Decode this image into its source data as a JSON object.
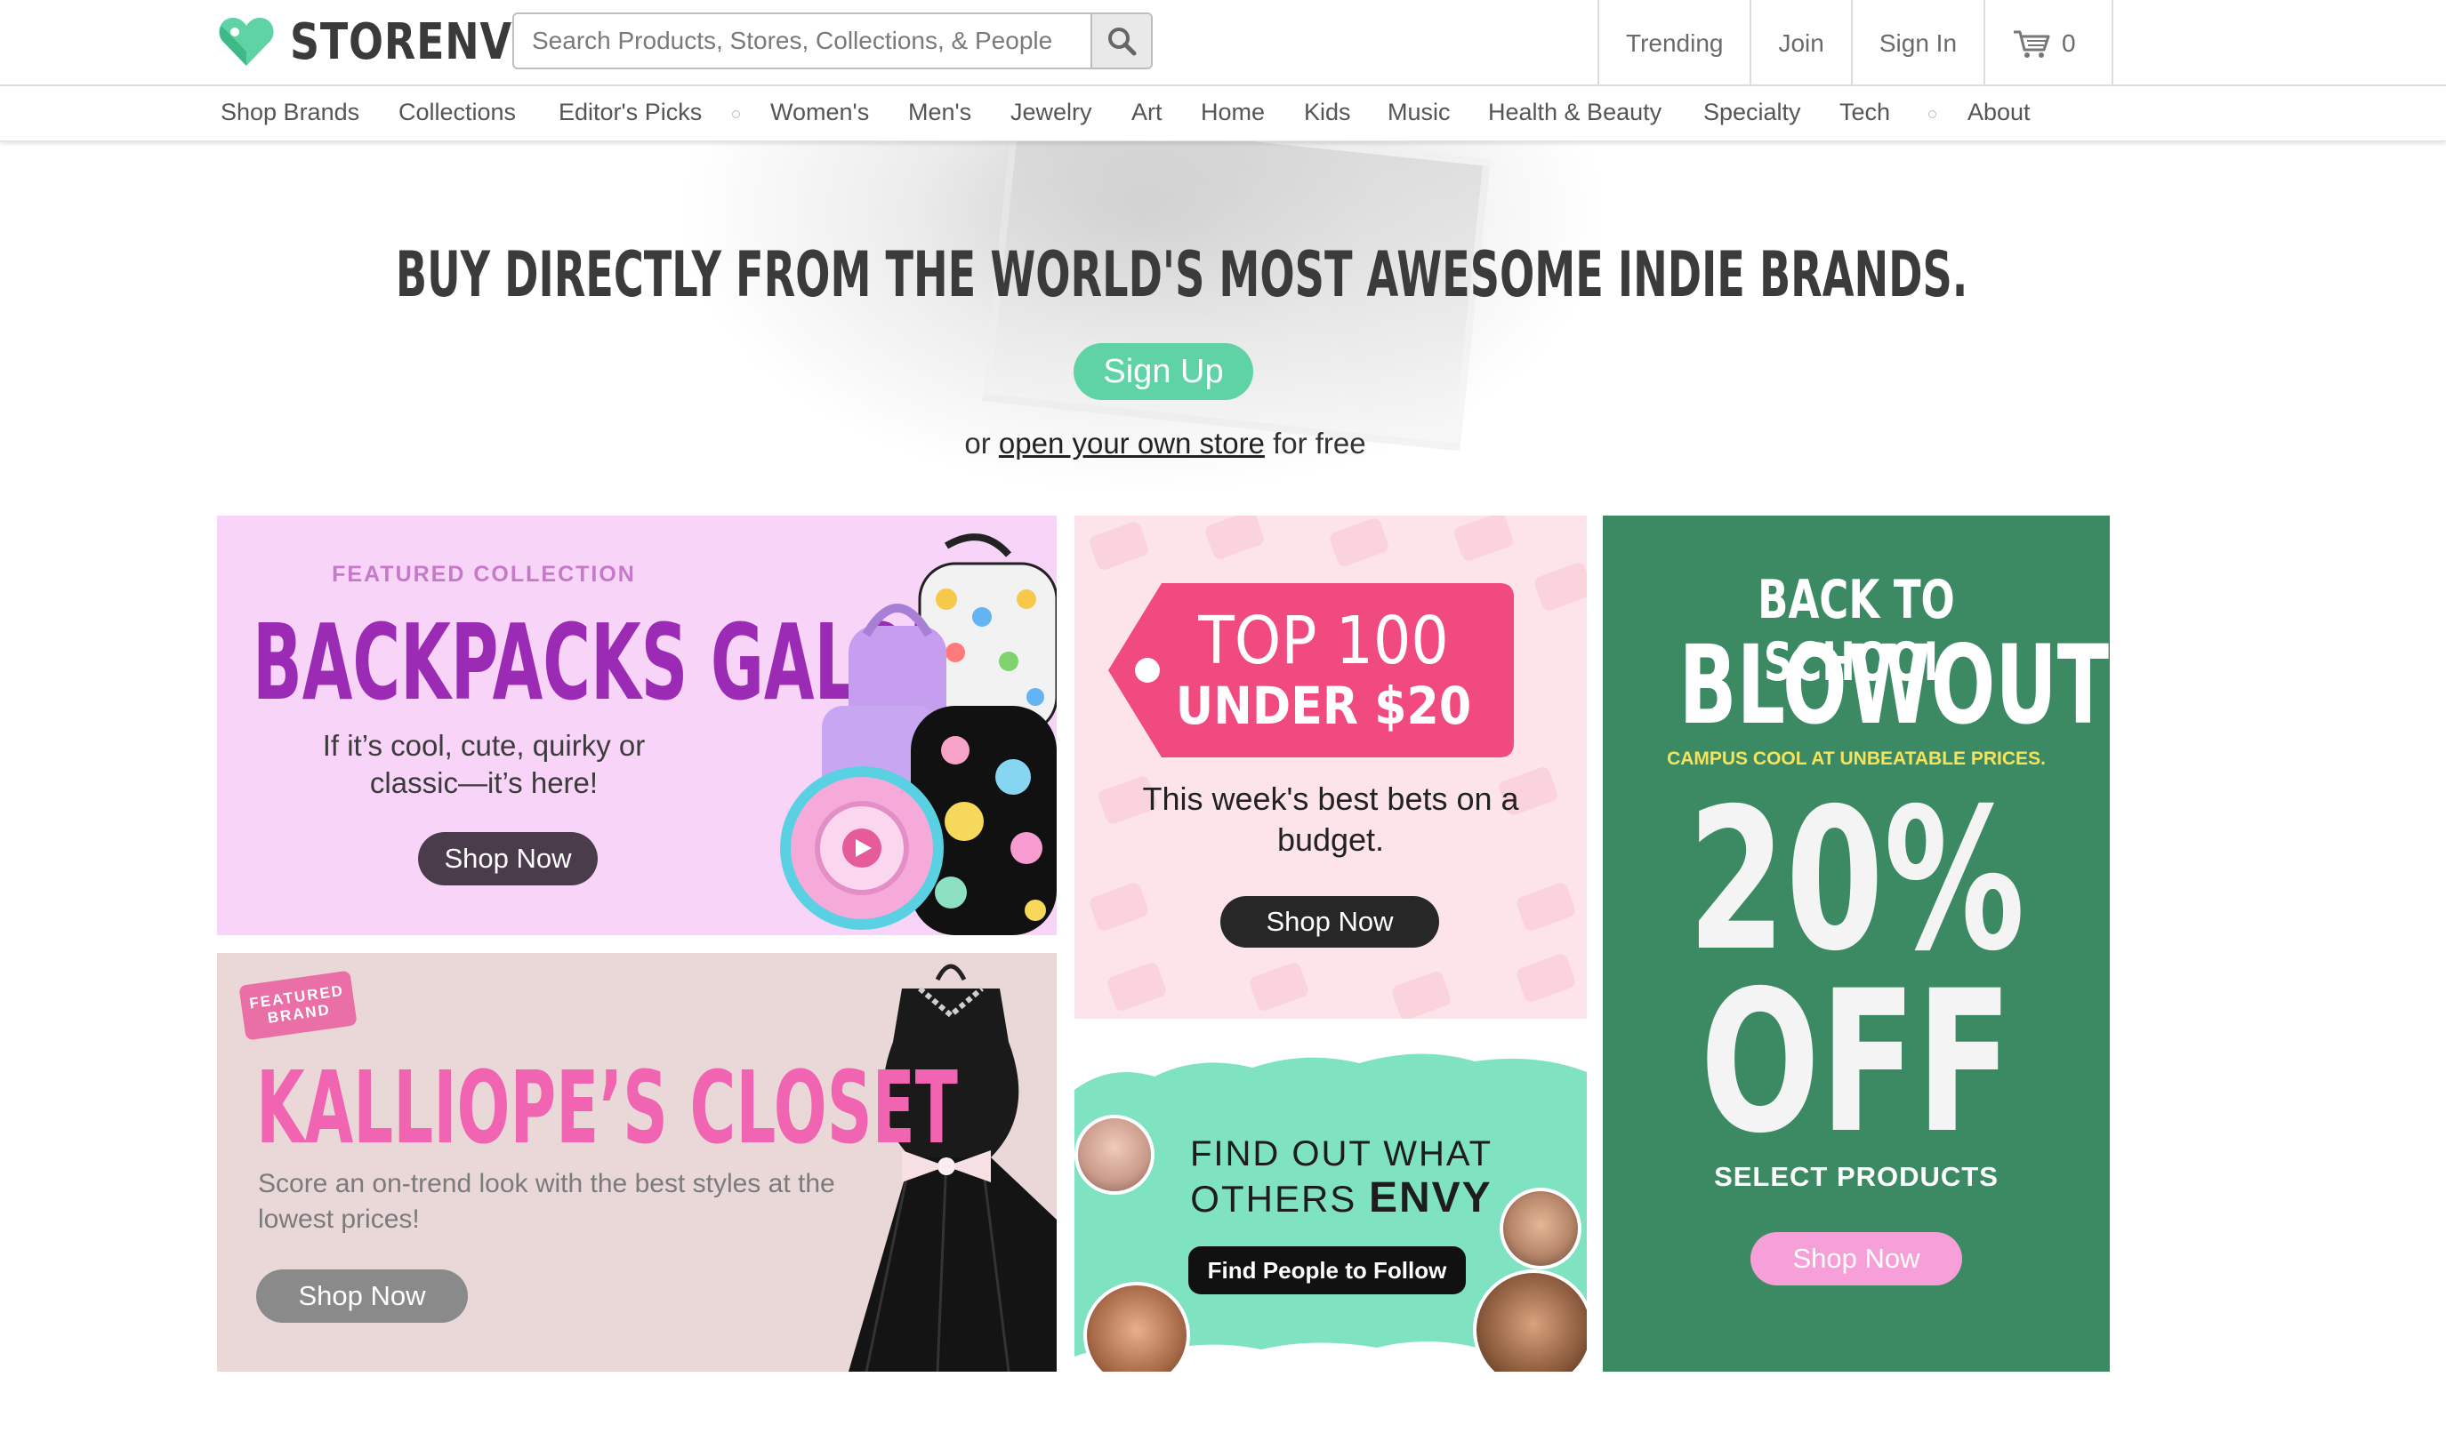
{
  "header": {
    "logo_text": "STORENVY",
    "search": {
      "placeholder": "Search Products, Stores, Collections, & People",
      "value": ""
    },
    "nav": {
      "trending": "Trending",
      "join": "Join",
      "sign_in": "Sign In",
      "cart_count": "0"
    }
  },
  "category_nav": {
    "items": [
      "Shop Brands",
      "Collections",
      "Editor's Picks",
      "Women's",
      "Men's",
      "Jewelry",
      "Art",
      "Home",
      "Kids",
      "Music",
      "Health & Beauty",
      "Specialty",
      "Tech",
      "About"
    ]
  },
  "hero": {
    "title": "BUY DIRECTLY FROM THE WORLD'S MOST AWESOME INDIE BRANDS.",
    "signup_label": "Sign Up",
    "sub_prefix": "or ",
    "sub_link": "open your own store",
    "sub_suffix": " for free"
  },
  "tiles": {
    "backpacks": {
      "label": "FEATURED COLLECTION",
      "title": "BACKPACKS GALORE",
      "desc": "If it’s cool, cute, quirky or classic—it’s here!",
      "button": "Shop Now"
    },
    "top100": {
      "line1": "TOP 100",
      "line2": "UNDER $20",
      "desc": "This week's best bets on a budget.",
      "button": "Shop Now"
    },
    "school": {
      "title1": "BACK TO SCHOOL",
      "title2": "BLOWOUT",
      "tagline": "CAMPUS COOL AT UNBEATABLE PRICES.",
      "percent": "20%",
      "off": "OFF",
      "select": "SELECT PRODUCTS",
      "button": "Shop Now"
    },
    "kalliope": {
      "badge": "FEATURED BRAND",
      "title": "KALLIOPE’S CLOSET",
      "desc": "Score an on-trend look with the best styles at the lowest prices!",
      "button": "Shop Now"
    },
    "envy": {
      "line1": "FIND OUT WHAT",
      "line2_prefix": "OTHERS ",
      "line2_bold": "ENVY",
      "button": "Find People to Follow"
    }
  },
  "colors": {
    "brand_green": "#5fd3a6",
    "backpack_purple": "#9b2bb5",
    "top100_pink": "#f04a7f",
    "school_green": "#3c8a63",
    "kalliope_pink": "#f064b2",
    "envy_mint": "#7fe3c1"
  }
}
